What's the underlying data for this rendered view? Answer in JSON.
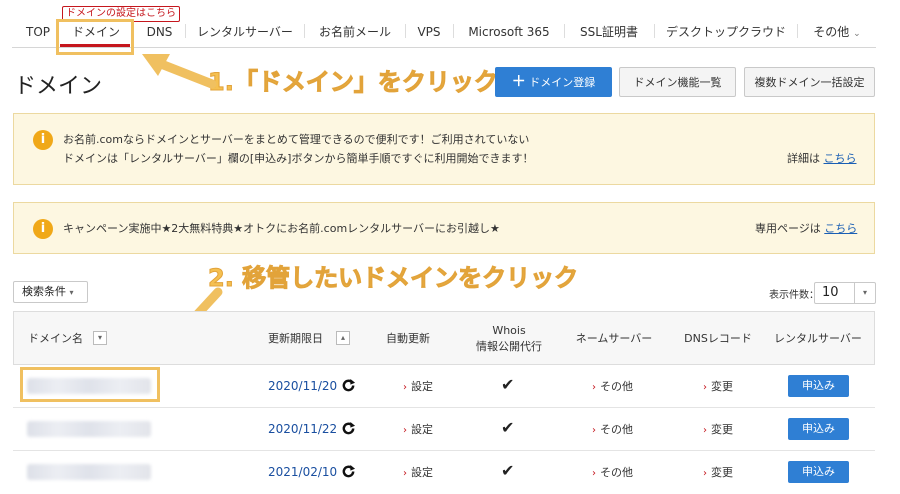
{
  "nav": {
    "tooltip": "ドメインの設定はこちら",
    "items": [
      {
        "label": "TOP"
      },
      {
        "label": "ドメイン"
      },
      {
        "label": "DNS"
      },
      {
        "label": "レンタルサーバー"
      },
      {
        "label": "お名前メール"
      },
      {
        "label": "VPS"
      },
      {
        "label": "Microsoft 365"
      },
      {
        "label": "SSL証明書"
      },
      {
        "label": "デスクトップクラウド"
      },
      {
        "label": "その他"
      }
    ]
  },
  "page": {
    "title": "ドメイン",
    "buttons": {
      "register": "ドメイン登録",
      "features": "ドメイン機能一覧",
      "bulk": "複数ドメイン一括設定"
    }
  },
  "annotations": {
    "step1": "1.「ドメイン」をクリック",
    "step2": "2. 移管したいドメインをクリック"
  },
  "notices": [
    {
      "line1": "お名前.comならドメインとサーバーをまとめて管理できるので便利です！ご利用されていない",
      "line2": "ドメインは「レンタルサーバー」欄の[申込み]ボタンから簡単手順ですぐに利用開始できます！",
      "link_prefix": "詳細は",
      "link": "こちら"
    },
    {
      "line1": "キャンペーン実施中★2大無料特典★オトクにお名前.comレンタルサーバーにお引越し★",
      "link_prefix": "専用ページは",
      "link": "こちら"
    }
  ],
  "filter": {
    "search_label": "検索条件",
    "count_label": "表示件数：",
    "count_value": "10"
  },
  "table": {
    "headers": {
      "domain": "ドメイン名",
      "expiry": "更新期限日",
      "auto_renew": "自動更新",
      "whois_1": "Whois",
      "whois_2": "情報公開代行",
      "nameserver": "ネームサーバー",
      "dns": "DNSレコード",
      "server": "レンタルサーバー"
    },
    "rows": [
      {
        "date": "2020/11/20",
        "auto": "設定",
        "ns": "その他",
        "dns": "変更",
        "apply": "申込み"
      },
      {
        "date": "2020/11/22",
        "auto": "設定",
        "ns": "その他",
        "dns": "変更",
        "apply": "申込み"
      },
      {
        "date": "2021/02/10",
        "auto": "設定",
        "ns": "その他",
        "dns": "変更",
        "apply": "申込み"
      }
    ]
  },
  "colors": {
    "accent": "#c5161d",
    "primary": "#2f7fd4",
    "annotation": "#f5c051",
    "notice_bg": "#fdf7e1"
  }
}
